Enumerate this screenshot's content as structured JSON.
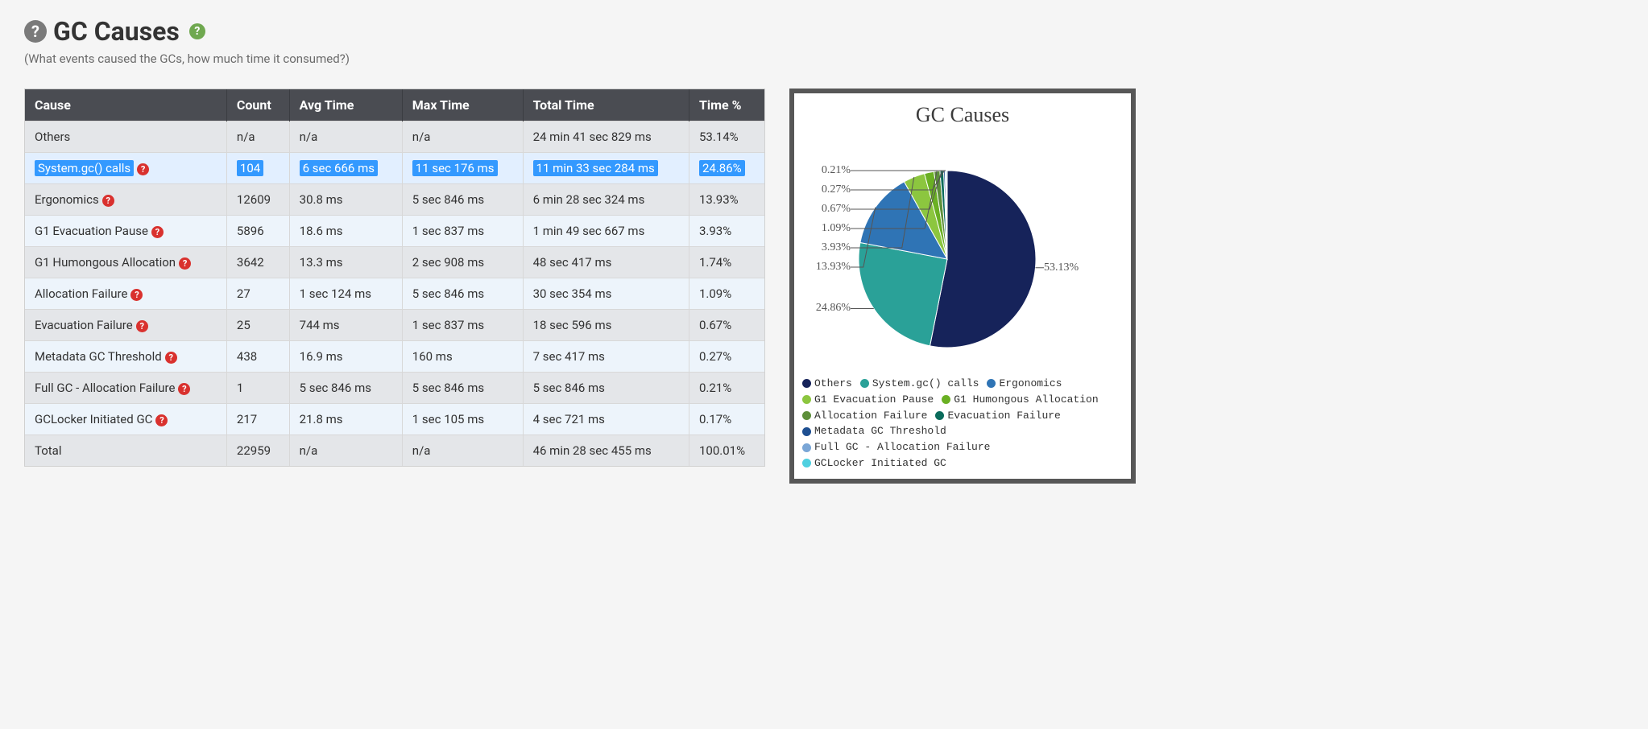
{
  "header": {
    "title": "GC Causes",
    "subtitle": "(What events caused the GCs, how much time it consumed?)"
  },
  "table": {
    "columns": [
      "Cause",
      "Count",
      "Avg Time",
      "Max Time",
      "Total Time",
      "Time %"
    ],
    "rows": [
      {
        "cause": "Others",
        "count": "n/a",
        "avg": "n/a",
        "max": "n/a",
        "total": "24 min 41 sec 829 ms",
        "pct": "53.14%",
        "help": false,
        "selected": false
      },
      {
        "cause": "System.gc() calls",
        "count": "104",
        "avg": "6 sec 666 ms",
        "max": "11 sec 176 ms",
        "total": "11 min 33 sec 284 ms",
        "pct": "24.86%",
        "help": true,
        "selected": true
      },
      {
        "cause": "Ergonomics",
        "count": "12609",
        "avg": "30.8 ms",
        "max": "5 sec 846 ms",
        "total": "6 min 28 sec 324 ms",
        "pct": "13.93%",
        "help": true,
        "selected": false
      },
      {
        "cause": "G1 Evacuation Pause",
        "count": "5896",
        "avg": "18.6 ms",
        "max": "1 sec 837 ms",
        "total": "1 min 49 sec 667 ms",
        "pct": "3.93%",
        "help": true,
        "selected": false
      },
      {
        "cause": "G1 Humongous Allocation",
        "count": "3642",
        "avg": "13.3 ms",
        "max": "2 sec 908 ms",
        "total": "48 sec 417 ms",
        "pct": "1.74%",
        "help": true,
        "selected": false
      },
      {
        "cause": "Allocation Failure",
        "count": "27",
        "avg": "1 sec 124 ms",
        "max": "5 sec 846 ms",
        "total": "30 sec 354 ms",
        "pct": "1.09%",
        "help": true,
        "selected": false
      },
      {
        "cause": "Evacuation Failure",
        "count": "25",
        "avg": "744 ms",
        "max": "1 sec 837 ms",
        "total": "18 sec 596 ms",
        "pct": "0.67%",
        "help": true,
        "selected": false
      },
      {
        "cause": "Metadata GC Threshold",
        "count": "438",
        "avg": "16.9 ms",
        "max": "160 ms",
        "total": "7 sec 417 ms",
        "pct": "0.27%",
        "help": true,
        "selected": false
      },
      {
        "cause": "Full GC - Allocation Failure",
        "count": "1",
        "avg": "5 sec 846 ms",
        "max": "5 sec 846 ms",
        "total": "5 sec 846 ms",
        "pct": "0.21%",
        "help": true,
        "selected": false
      },
      {
        "cause": "GCLocker Initiated GC",
        "count": "217",
        "avg": "21.8 ms",
        "max": "1 sec 105 ms",
        "total": "4 sec 721 ms",
        "pct": "0.17%",
        "help": true,
        "selected": false
      },
      {
        "cause": "Total",
        "count": "22959",
        "avg": "n/a",
        "max": "n/a",
        "total": "46 min 28 sec 455 ms",
        "pct": "100.01%",
        "help": false,
        "selected": false
      }
    ]
  },
  "chart_data": {
    "type": "pie",
    "title": "GC Causes",
    "series": [
      {
        "name": "Others",
        "value": 53.13,
        "label": "53.13%",
        "color": "#16235a"
      },
      {
        "name": "System.gc() calls",
        "value": 24.86,
        "label": "24.86%",
        "color": "#2aa198"
      },
      {
        "name": "Ergonomics",
        "value": 13.93,
        "label": "13.93%",
        "color": "#2f74b5"
      },
      {
        "name": "G1 Evacuation Pause",
        "value": 3.93,
        "label": "3.93%",
        "color": "#8cc63f"
      },
      {
        "name": "G1 Humongous Allocation",
        "value": 1.74,
        "label": "",
        "color": "#6ab023"
      },
      {
        "name": "Allocation Failure",
        "value": 1.09,
        "label": "1.09%",
        "color": "#5d8f3a"
      },
      {
        "name": "Evacuation Failure",
        "value": 0.67,
        "label": "0.67%",
        "color": "#0a6b5b"
      },
      {
        "name": "Metadata GC Threshold",
        "value": 0.27,
        "label": "0.27%",
        "color": "#1e4f91"
      },
      {
        "name": "Full GC - Allocation Failure",
        "value": 0.21,
        "label": "0.21%",
        "color": "#7aa6d6"
      },
      {
        "name": "GCLocker Initiated GC",
        "value": 0.17,
        "label": "",
        "color": "#4fd0e0"
      }
    ]
  }
}
